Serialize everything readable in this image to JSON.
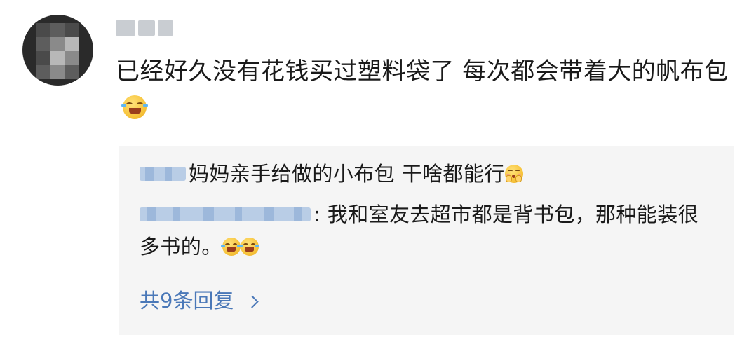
{
  "comment": {
    "text": "已经好久没有花钱买过塑料袋了 每次都会带着大的帆布包",
    "emoji": "crying-laughing-emoji"
  },
  "replies": [
    {
      "text": "妈妈亲手给做的小布包 干啥都能行",
      "emoji": "hugging-face-emoji"
    },
    {
      "separator": ":",
      "text": "我和室友去超市都是背书包，那种能装很多书的。",
      "emoji": "grinning-sweat-emoji"
    }
  ],
  "more_replies": {
    "label": "共9条回复",
    "icon": "chevron-right-icon"
  },
  "colors": {
    "link": "#4a78b8",
    "reply_bg": "#f5f5f5",
    "text": "#1a1a1a"
  }
}
